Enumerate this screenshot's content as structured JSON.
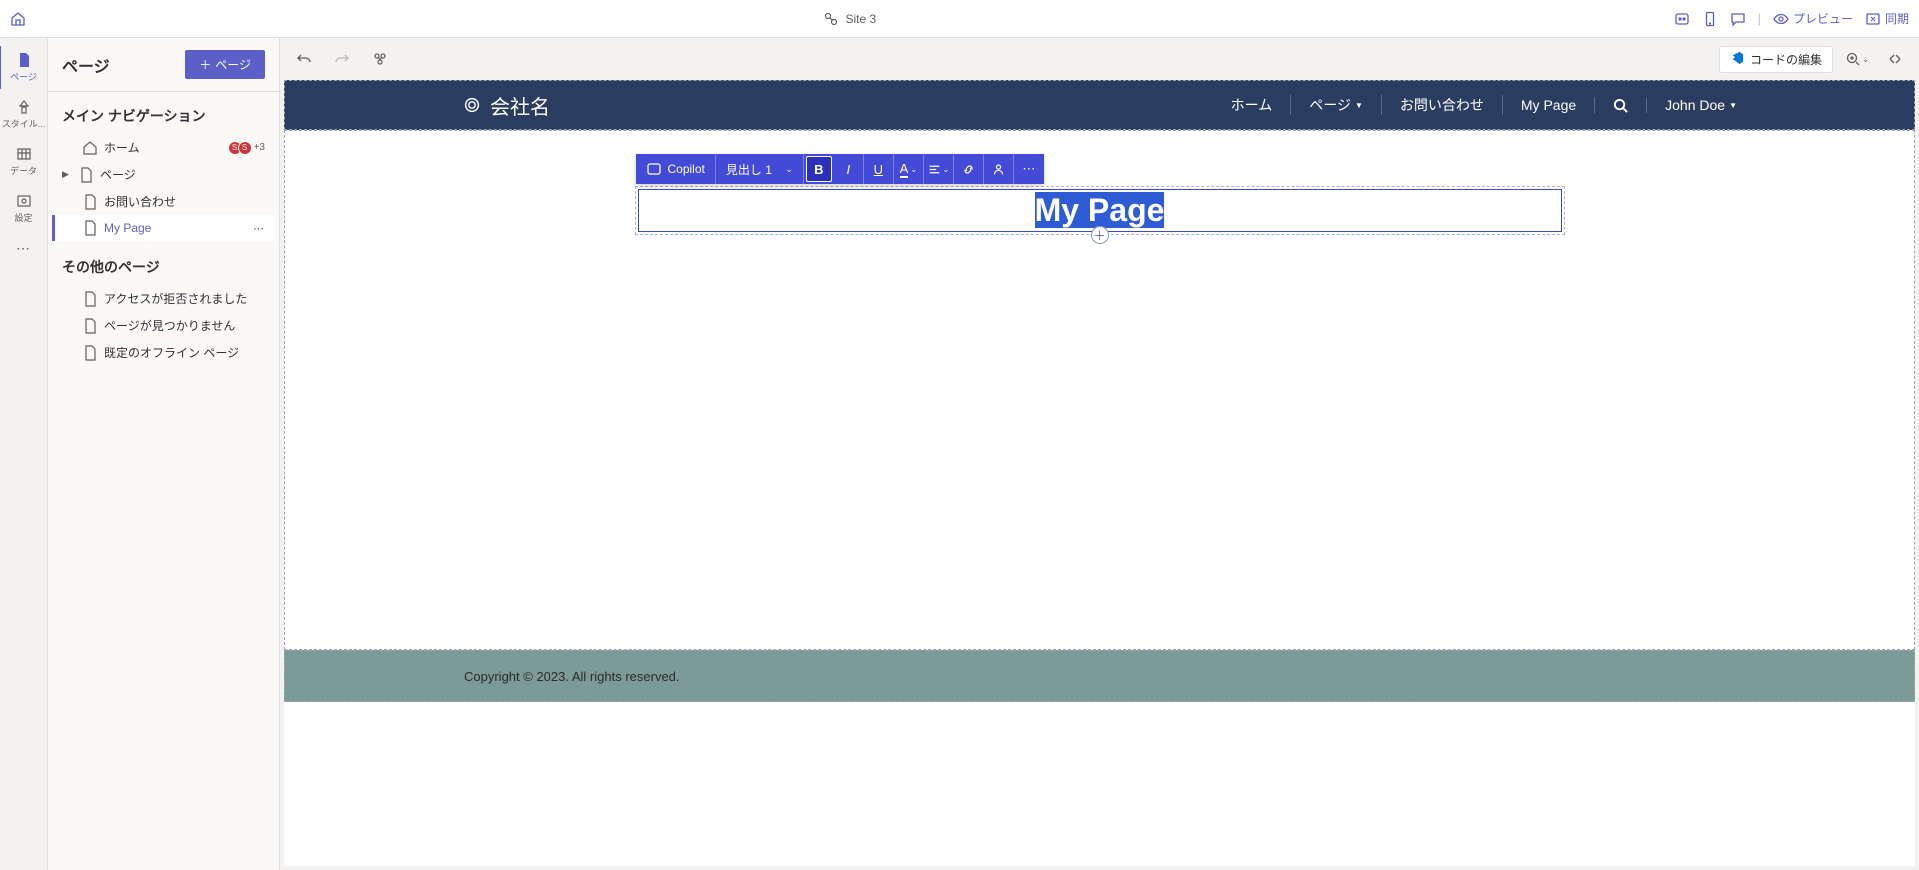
{
  "header": {
    "site_label": "Site 3"
  },
  "header_right": {
    "preview": "プレビュー",
    "sync": "同期"
  },
  "rail": {
    "page": "ページ",
    "style": "スタイル...",
    "data": "データ",
    "settings": "設定"
  },
  "side": {
    "title": "ページ",
    "add_btn": "ページ",
    "section_main": "メイン ナビゲーション",
    "section_other": "その他のページ",
    "main_items": {
      "home": "ホーム",
      "page": "ページ",
      "contact": "お問い合わせ",
      "my_page": "My Page"
    },
    "other_items": {
      "denied": "アクセスが拒否されました",
      "notfound": "ページが見つかりません",
      "offline": "既定のオフライン ページ"
    },
    "badge_extra": "+3"
  },
  "canvas_toolbar": {
    "code_edit": "コードの編集"
  },
  "site": {
    "brand": "会社名",
    "nav": {
      "home": "ホーム",
      "page": "ページ",
      "contact": "お問い合わせ",
      "my_page": "My Page",
      "user": "John Doe"
    },
    "heading": "My Page",
    "footer": "Copyright © 2023. All rights reserved."
  },
  "rte": {
    "copilot": "Copilot",
    "style_name": "見出し 1"
  }
}
